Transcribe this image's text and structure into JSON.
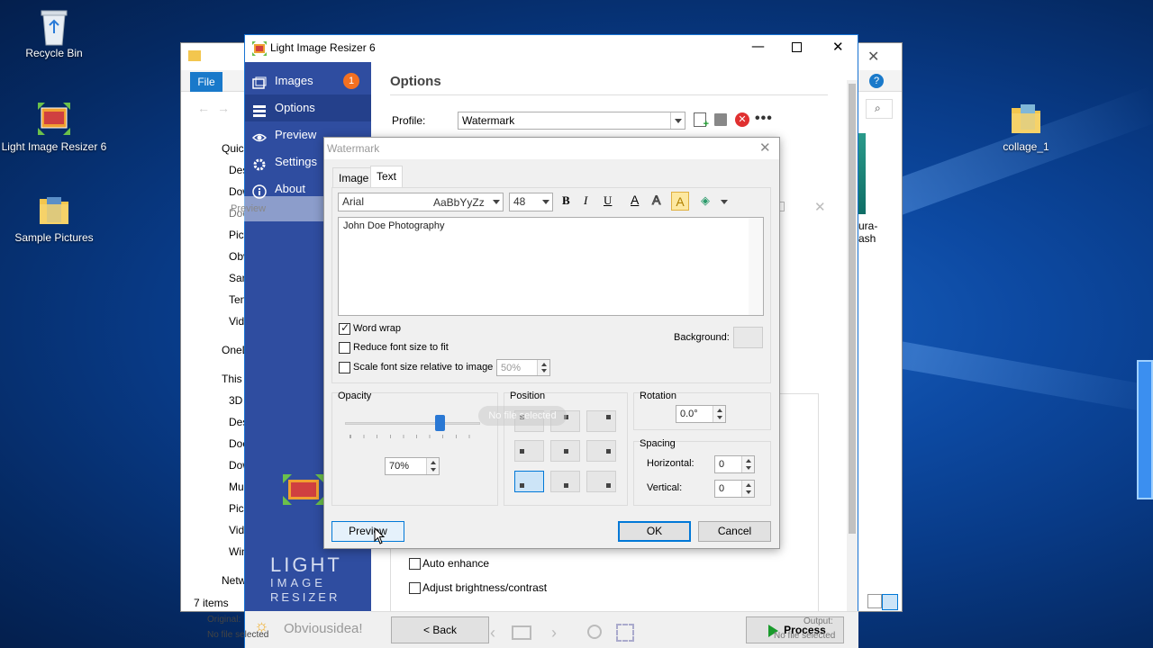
{
  "desktop": {
    "icons": [
      {
        "label": "Recycle Bin"
      },
      {
        "label": "Light Image Resizer 6"
      },
      {
        "label": "Sample Pictures"
      },
      {
        "label": "collage_1"
      }
    ]
  },
  "explorer": {
    "file_tab": "File",
    "nav": [
      "Quic",
      "Des",
      "Dow",
      "Doc",
      "Pict",
      "Obv",
      "Sam",
      "Ten",
      "Vid",
      "OneD",
      "This",
      "3D",
      "Des",
      "Doc",
      "Dow",
      "Mu",
      "Pic",
      "Vid",
      "Win",
      "Netw"
    ],
    "right_item_label_1": "ura-",
    "right_item_label_2": "ash",
    "status": "7 items"
  },
  "app": {
    "title": "Light Image Resizer 6",
    "sidebar": {
      "items": [
        {
          "label": "Images",
          "badge": "1"
        },
        {
          "label": "Options"
        },
        {
          "label": "Preview"
        },
        {
          "label": "Settings"
        },
        {
          "label": "About"
        }
      ],
      "logo_line1": "LIGHT",
      "logo_line2": "IMAGE",
      "logo_line3": "RESIZER",
      "brand": "Obviousidea!",
      "original_label": "Original:",
      "original_value": "No file selected"
    },
    "options": {
      "heading": "Options",
      "profile_label": "Profile:",
      "profile_value": "Watermark",
      "auto_enhance": "Auto enhance",
      "adjust_brightness": "Adjust brightness/contrast"
    },
    "bottom": {
      "back_label": "< Back",
      "process_label": "Process",
      "output_label": "Output:",
      "output_value": "No file selected"
    },
    "ghost_preview_title": "Preview",
    "ghost_no_file": "No file selected"
  },
  "watermark_dialog": {
    "title": "Watermark",
    "tabs": [
      "Image",
      "Text"
    ],
    "active_tab": "Text",
    "font_name": "Arial",
    "font_sample": "AaBbYyZz",
    "font_size": "48",
    "bold": "B",
    "italic": "I",
    "underline": "U",
    "text_value": "John Doe Photography",
    "word_wrap": "Word wrap",
    "reduce_font": "Reduce font size to fit",
    "scale_font": "Scale font size relative to image",
    "scale_value": "50%",
    "background_label": "Background:",
    "opacity_label": "Opacity",
    "opacity_value": "70%",
    "opacity_fraction": 0.7,
    "position_label": "Position",
    "rotation_label": "Rotation",
    "rotation_value": "0.0°",
    "spacing_label": "Spacing",
    "horizontal_label": "Horizontal:",
    "horizontal_value": "0",
    "vertical_label": "Vertical:",
    "vertical_value": "0",
    "preview_button": "Preview",
    "ok_button": "OK",
    "cancel_button": "Cancel"
  },
  "colors": {
    "sidebar": "#2f4da0",
    "accent": "#0078d7",
    "badge": "#f37021",
    "process_green": "#1a9b2c"
  }
}
